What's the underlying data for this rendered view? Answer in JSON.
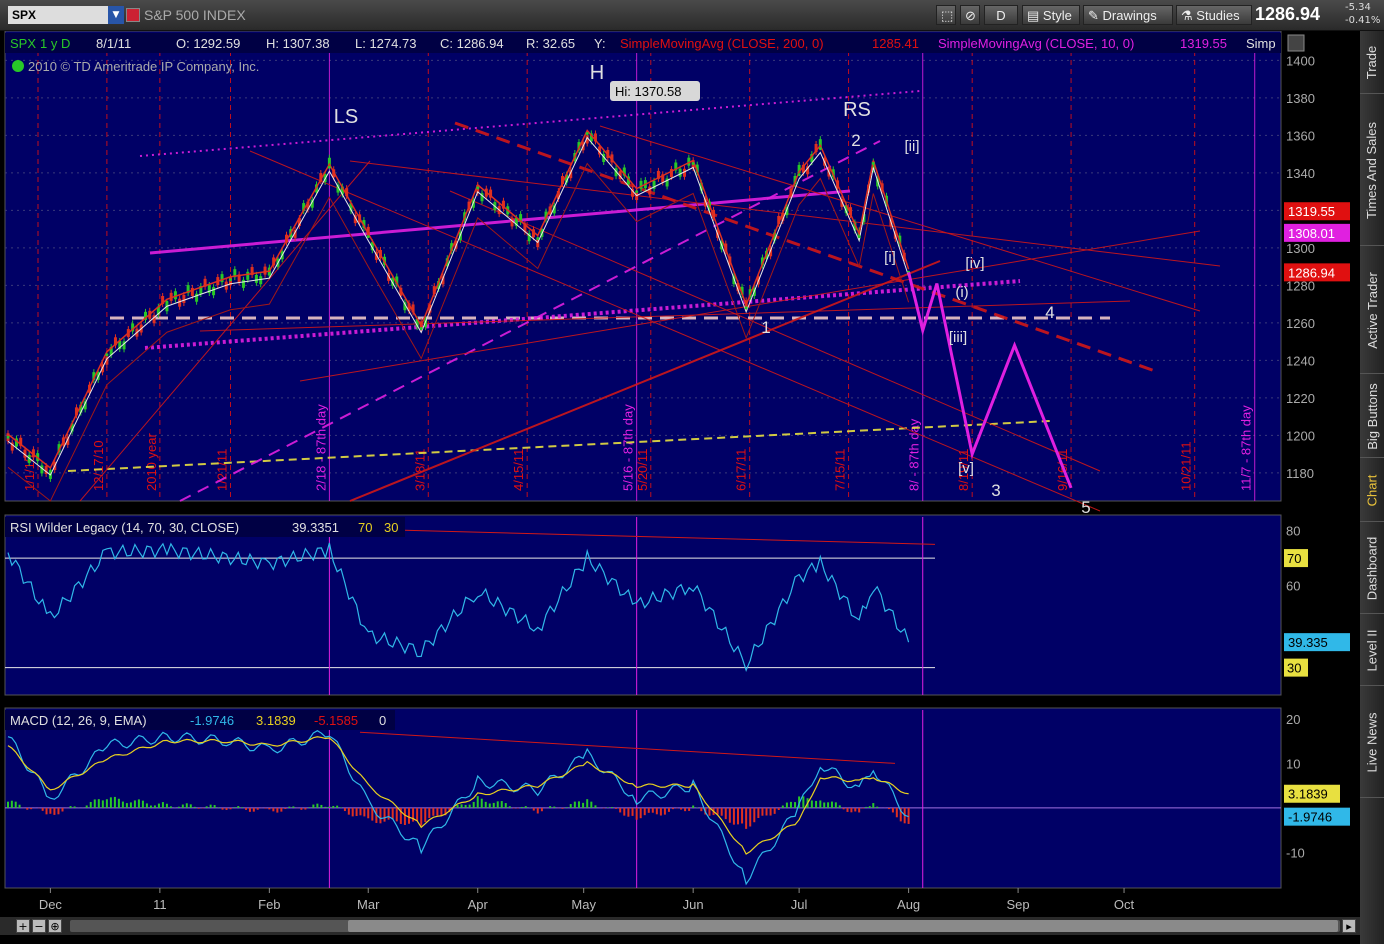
{
  "toolbar": {
    "symbol": "SPX",
    "index_name": "S&P 500 INDEX",
    "period_button": "D",
    "style_label": "Style",
    "drawings_label": "Drawings",
    "studies_label": "Studies",
    "last_price": "1286.94",
    "change": "-5.34",
    "change_pct": "-0.41%"
  },
  "sidebar": {
    "tabs": [
      "Trade",
      "Times And Sales",
      "Active Trader",
      "Big Buttons",
      "Chart",
      "Dashboard",
      "Level II",
      "Live News"
    ],
    "active": "Chart"
  },
  "price_panel": {
    "header": {
      "symbol": "SPX",
      "range": "1 y D",
      "date": "8/1/11",
      "open": "O: 1292.59",
      "high": "H: 1307.38",
      "low": "L: 1274.73",
      "close": "C: 1286.94",
      "range_val": "R: 32.65",
      "y": "Y:",
      "sma200": "SimpleMovingAvg (CLOSE, 200, 0)",
      "sma200_val": "1285.41",
      "sma10": "SimpleMovingAvg (CLOSE, 10, 0)",
      "sma10_val": "1319.55",
      "simp": "Simp"
    },
    "copyright": "2010 © TD Ameritrade IP Company, Inc.",
    "price_labels": [
      {
        "text": "1319.55",
        "color": "#e01010",
        "value": 1319.55
      },
      {
        "text": "1308.01",
        "color": "#e020e0",
        "value": 1308.01
      },
      {
        "text": "1286.94",
        "color": "#e01010",
        "value": 1286.94
      }
    ],
    "hi_label": "Hi: 1370.58",
    "annotations": [
      "LS",
      "H",
      "RS",
      "2",
      "[ii]",
      "[i]",
      "[iv]",
      "(i)",
      "[iii]",
      "1",
      "4",
      "[v]",
      "3",
      "5"
    ],
    "vlines": [
      {
        "text": "1/1/10",
        "color": "#e01010"
      },
      {
        "text": "12/17/10",
        "color": "#e01010"
      },
      {
        "text": "2010 year",
        "color": "#e01010"
      },
      {
        "text": "1/21/11",
        "color": "#e01010"
      },
      {
        "text": "2/18 - 87th day",
        "color": "#e020e0"
      },
      {
        "text": "3/18/11",
        "color": "#e01010"
      },
      {
        "text": "4/15/11",
        "color": "#e01010"
      },
      {
        "text": "5/16 - 87th day",
        "color": "#e020e0"
      },
      {
        "text": "5/20/11",
        "color": "#e01010"
      },
      {
        "text": "6/17/11",
        "color": "#e01010"
      },
      {
        "text": "7/15/11",
        "color": "#e01010"
      },
      {
        "text": "8/ - 87th day",
        "color": "#e020e0"
      },
      {
        "text": "8/19/11",
        "color": "#e01010"
      },
      {
        "text": "9/16/11",
        "color": "#e01010"
      },
      {
        "text": "10/21/11",
        "color": "#e01010"
      },
      {
        "text": "11/7 - 87th day",
        "color": "#e020e0"
      }
    ]
  },
  "rsi_panel": {
    "title": "RSI Wilder Legacy (14, 70, 30, CLOSE)",
    "value": "39.3351",
    "ob": "70",
    "os": "30",
    "last_label": "39.335"
  },
  "macd_panel": {
    "title": "MACD (12, 26, 9, EMA)",
    "macd": "-1.9746",
    "signal": "3.1839",
    "hist": "-5.1585",
    "zero": "0",
    "signal_label": "3.1839",
    "macd_label": "-1.9746"
  },
  "chart_data": [
    {
      "type": "line",
      "title": "SPX 1 y D",
      "ylim": [
        1165,
        1405
      ],
      "yticks": [
        1180,
        1200,
        1220,
        1240,
        1260,
        1280,
        1300,
        1320,
        1340,
        1360,
        1380,
        1400
      ],
      "x_labels": [
        "Dec",
        "11",
        "Feb",
        "Mar",
        "Apr",
        "May",
        "Jun",
        "Jul",
        "Aug",
        "Sep",
        "Oct"
      ],
      "x": [
        "11/19/10",
        "12/1/10",
        "12/17/10",
        "1/3/11",
        "1/21/11",
        "2/1/11",
        "2/18/11",
        "3/1/11",
        "3/16/11",
        "4/1/11",
        "4/18/11",
        "5/2/11",
        "5/16/11",
        "6/1/11",
        "6/16/11",
        "7/1/11",
        "7/7/11",
        "7/18/11",
        "7/22/11",
        "8/1/11"
      ],
      "series": [
        {
          "name": "SPX",
          "values": [
            1199,
            1181,
            1243,
            1271,
            1283,
            1286,
            1343,
            1306,
            1257,
            1332,
            1305,
            1361,
            1330,
            1345,
            1268,
            1339,
            1353,
            1306,
            1345,
            1287
          ]
        }
      ],
      "projection": {
        "x": [
          "8/1/11",
          "8/5/11",
          "8/9/11",
          "8/19/11",
          "8/31/11",
          "9/16/11"
        ],
        "values": [
          1287,
          1256,
          1281,
          1190,
          1248,
          1172
        ]
      }
    },
    {
      "type": "line",
      "title": "RSI Wilder Legacy (14, 70, 30, CLOSE)",
      "ylim": [
        20,
        85
      ],
      "yticks": [
        40,
        60,
        80
      ],
      "series": [
        {
          "name": "RSI",
          "values": [
            72,
            48,
            72,
            73,
            70,
            68,
            73,
            42,
            36,
            58,
            44,
            70,
            53,
            60,
            31,
            63,
            68,
            47,
            60,
            39.3
          ]
        }
      ]
    },
    {
      "type": "bar",
      "title": "MACD (12, 26, 9, EMA)",
      "ylim": [
        -18,
        22
      ],
      "yticks": [
        -10,
        10,
        20
      ],
      "series": [
        {
          "name": "MACD",
          "values": [
            16,
            2,
            14,
            16,
            15,
            13,
            17,
            1,
            -9,
            6,
            4,
            12,
            2,
            5,
            -16,
            0,
            10,
            4,
            9,
            -1.97
          ]
        },
        {
          "name": "Signal",
          "values": [
            14,
            4,
            11,
            15,
            15,
            14,
            16,
            5,
            -4,
            3,
            5,
            10,
            5,
            5,
            -10,
            -3,
            7,
            6,
            7,
            3.18
          ]
        }
      ]
    }
  ],
  "colors": {
    "background": "#000066",
    "grid": "#3a3a7a",
    "price_up": "#28c828",
    "price_down": "#e03020",
    "trend_red": "#d01818",
    "magenta": "#e020e0",
    "yellow": "#e8e040",
    "rsi": "#30b8e8",
    "macd": "#30b8e8",
    "signal": "#e8d020"
  }
}
